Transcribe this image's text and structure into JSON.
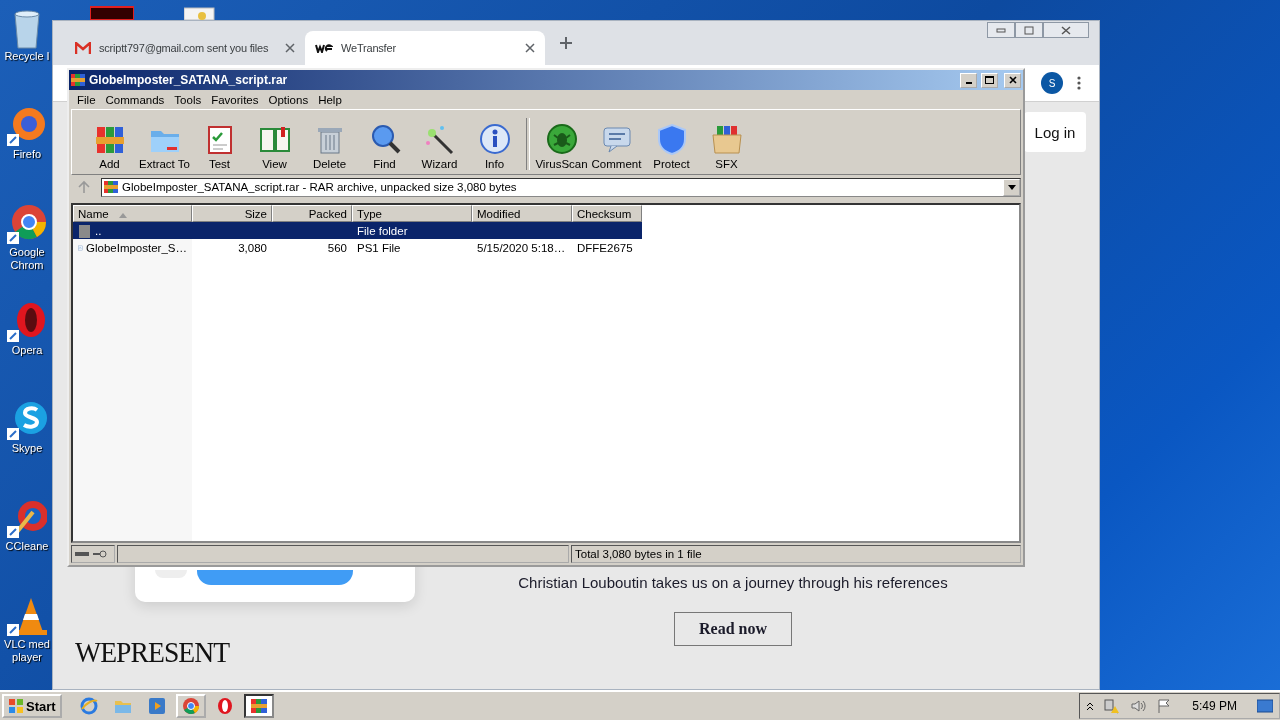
{
  "desktop_top_icons": [
    {
      "kind": "dark-app"
    },
    {
      "kind": "document"
    }
  ],
  "desktop_icons": [
    {
      "label": "Recycle I",
      "kind": "recycle"
    },
    {
      "label": "Firefo",
      "kind": "firefox"
    },
    {
      "label": "Google Chrom",
      "kind": "chrome"
    },
    {
      "label": "Opera",
      "kind": "opera"
    },
    {
      "label": "Skype",
      "kind": "skype"
    },
    {
      "label": "CCleane",
      "kind": "ccleaner"
    },
    {
      "label": "VLC med player",
      "kind": "vlc"
    }
  ],
  "browser": {
    "tabs": [
      {
        "title": "scriptt797@gmail.com sent you files",
        "kind": "gmail",
        "selected": false
      },
      {
        "title": "WeTransfer",
        "kind": "wetransfer",
        "selected": true
      }
    ],
    "avatar": "S",
    "login": "Log in",
    "headline": "Christian Louboutin takes us on a journey through his references",
    "cta": "Read now",
    "brand": "WEPRESENT"
  },
  "winrar": {
    "title": "GlobeImposter_SATANA_script.rar",
    "menu": [
      "File",
      "Commands",
      "Tools",
      "Favorites",
      "Options",
      "Help"
    ],
    "toolbar_groups": [
      [
        {
          "label": "Add",
          "kind": "add"
        },
        {
          "label": "Extract To",
          "kind": "extract"
        },
        {
          "label": "Test",
          "kind": "test"
        },
        {
          "label": "View",
          "kind": "view"
        },
        {
          "label": "Delete",
          "kind": "delete"
        },
        {
          "label": "Find",
          "kind": "find"
        },
        {
          "label": "Wizard",
          "kind": "wizard"
        },
        {
          "label": "Info",
          "kind": "info"
        }
      ],
      [
        {
          "label": "VirusScan",
          "kind": "virusscan"
        },
        {
          "label": "Comment",
          "kind": "comment"
        },
        {
          "label": "Protect",
          "kind": "protect"
        },
        {
          "label": "SFX",
          "kind": "sfx"
        }
      ]
    ],
    "address": "GlobeImposter_SATANA_script.rar - RAR archive, unpacked size 3,080 bytes",
    "columns": [
      {
        "label": "Name",
        "sorted": true
      },
      {
        "label": "Size",
        "sorted": false
      },
      {
        "label": "Packed",
        "sorted": false
      },
      {
        "label": "Type",
        "sorted": false
      },
      {
        "label": "Modified",
        "sorted": false
      },
      {
        "label": "Checksum",
        "sorted": false
      }
    ],
    "rows": [
      {
        "kind": "folder",
        "selected": true,
        "cells": [
          "..",
          "",
          "",
          "File folder",
          "",
          ""
        ]
      },
      {
        "kind": "file",
        "selected": false,
        "cells": [
          "GlobeImposter_S…",
          "3,080",
          "560",
          "PS1 File",
          "5/15/2020 5:18…",
          "DFFE2675"
        ]
      }
    ],
    "status": "Total 3,080 bytes in 1 file"
  },
  "taskbar": {
    "start": "Start",
    "apps": [
      {
        "kind": "ie",
        "running": false,
        "selected": false
      },
      {
        "kind": "explorer",
        "running": false,
        "selected": false
      },
      {
        "kind": "media",
        "running": false,
        "selected": false
      },
      {
        "kind": "chrome",
        "running": true,
        "selected": false
      },
      {
        "kind": "opera",
        "running": false,
        "selected": false
      },
      {
        "kind": "winrar",
        "running": true,
        "selected": true
      }
    ],
    "clock": "5:49 PM"
  }
}
